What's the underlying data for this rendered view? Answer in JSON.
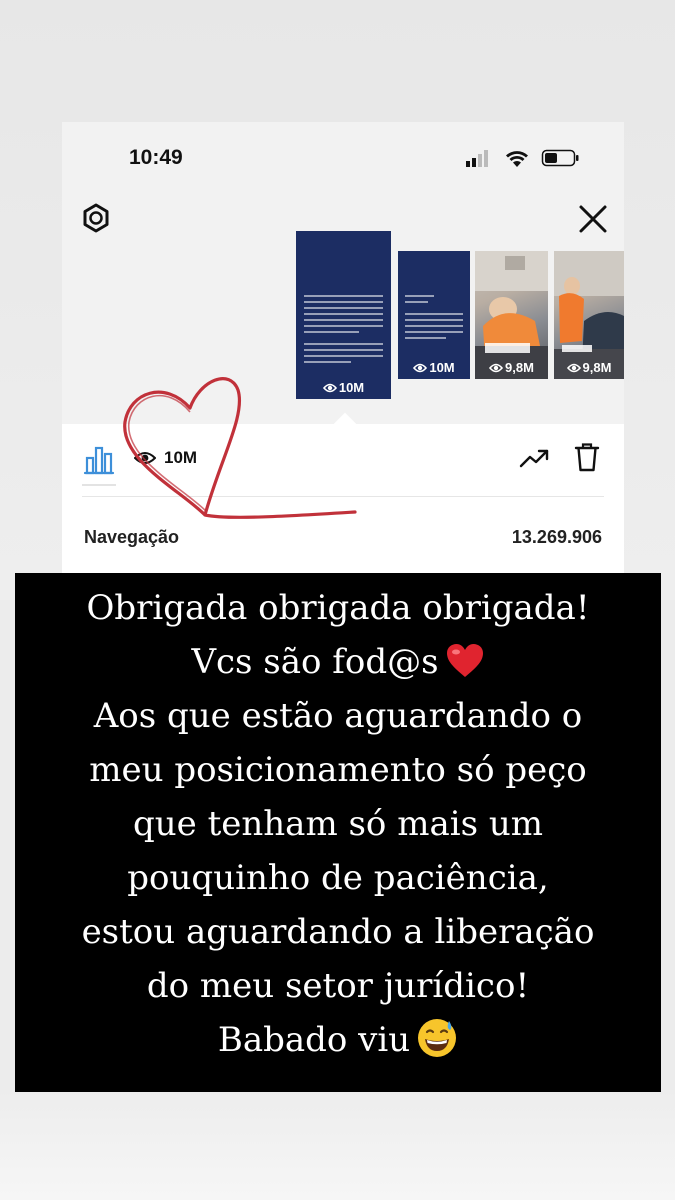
{
  "status_bar": {
    "time": "10:49"
  },
  "stories": [
    {
      "views": "10M",
      "type": "text"
    },
    {
      "views": "10M",
      "type": "text"
    },
    {
      "views": "9,8M",
      "type": "photo"
    },
    {
      "views": "9,8M",
      "type": "photo"
    }
  ],
  "insights": {
    "views": "10M",
    "navigation_label": "Navegação",
    "navigation_value": "13.269.906"
  },
  "caption": {
    "lines": [
      "Obrigada obrigada obrigada!",
      "Vcs são fod@s",
      "Aos que estão aguardando o",
      "meu posicionamento só peço",
      "que tenham só mais um",
      "pouquinho de paciência,",
      "estou aguardando a liberação",
      "do meu setor jurídico!",
      "Babado viu"
    ],
    "emoji_line2": "red-heart-icon",
    "emoji_line9": "grinning-sweat-icon"
  },
  "colors": {
    "accent_blue": "#3d8fd9",
    "story_navy": "#1c2d63",
    "heart_red": "#c1313a",
    "caption_bg": "#000000"
  }
}
